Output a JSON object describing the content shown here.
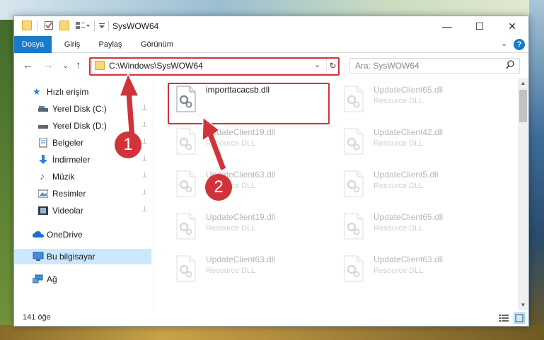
{
  "window": {
    "title": "SysWOW64",
    "controls": {
      "minimize": "—",
      "maximize": "☐",
      "close": "✕"
    }
  },
  "ribbon": {
    "tabs": [
      {
        "label": "Dosya",
        "active": true
      },
      {
        "label": "Giriş"
      },
      {
        "label": "Paylaş"
      },
      {
        "label": "Görünüm"
      }
    ],
    "expand_glyph": "⌄",
    "help_glyph": "?"
  },
  "nav": {
    "back_glyph": "←",
    "forward_glyph": "→",
    "recent_glyph": "⌄",
    "up_glyph": "↑",
    "address": "C:\\Windows\\SysWOW64",
    "dropdown_glyph": "⌄",
    "refresh_glyph": "↻",
    "search_placeholder": "Ara: SysWOW64",
    "search_glyph": "⌕"
  },
  "sidebar": {
    "items": [
      {
        "label": "Hızlı erişim",
        "icon": "star-icon",
        "pinned": false
      },
      {
        "label": "Yerel Disk (C:)",
        "icon": "drive-icon",
        "pinned": true
      },
      {
        "label": "Yerel Disk (D:)",
        "icon": "drive-icon",
        "pinned": true
      },
      {
        "label": "Belgeler",
        "icon": "documents-icon",
        "pinned": true
      },
      {
        "label": "İndirmeler",
        "icon": "download-icon",
        "pinned": true
      },
      {
        "label": "Müzik",
        "icon": "music-icon",
        "pinned": true
      },
      {
        "label": "Resimler",
        "icon": "pictures-icon",
        "pinned": true
      },
      {
        "label": "Videolar",
        "icon": "videos-icon",
        "pinned": true
      },
      {
        "label": "OneDrive",
        "icon": "cloud-icon"
      },
      {
        "label": "Bu bilgisayar",
        "icon": "computer-icon",
        "selected": true
      },
      {
        "label": "Ağ",
        "icon": "network-icon"
      }
    ],
    "pin_glyph": "📌"
  },
  "files": {
    "left_column": [
      {
        "name": "importtacacsb.dll",
        "type": ""
      },
      {
        "name": "UpdateClient19.dll",
        "type": "Resource DLL"
      },
      {
        "name": "UpdateClient63.dll",
        "type": "Resource DLL"
      },
      {
        "name": "UpdateClient19.dll",
        "type": "Resource DLL"
      },
      {
        "name": "UpdateClient63.dll",
        "type": "Resource DLL"
      }
    ],
    "right_column": [
      {
        "name": "UpdateClient65.dll",
        "type": "Resource DLL"
      },
      {
        "name": "UpdateClient42.dll",
        "type": "Resource DLL"
      },
      {
        "name": "UpdateClient5.dll",
        "type": "Resource DLL"
      },
      {
        "name": "UpdateClient65.dll",
        "type": "Resource DLL"
      },
      {
        "name": "UpdateClient63.dll",
        "type": "Resource DLL"
      }
    ]
  },
  "status": {
    "item_count": "141 öğe"
  },
  "annotations": {
    "badge1": "1",
    "badge2": "2",
    "highlight_color": "#d0333a"
  },
  "colors": {
    "accent": "#1979ca",
    "selection": "#cce8ff",
    "highlight": "#d0333a"
  }
}
